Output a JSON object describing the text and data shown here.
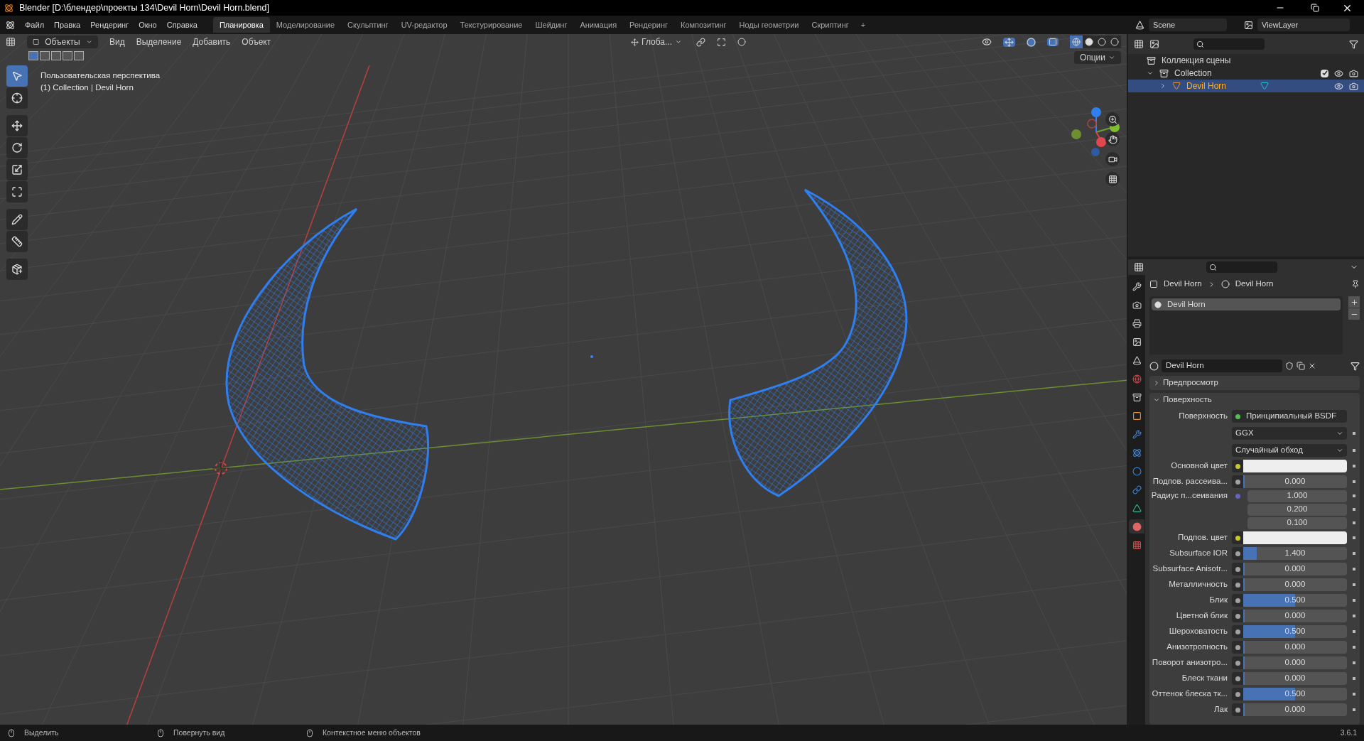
{
  "window": {
    "title": "Blender [D:\\блендер\\проекты 134\\Devil Horn\\Devil Horn.blend]"
  },
  "menu": [
    "Файл",
    "Правка",
    "Рендеринг",
    "Окно",
    "Справка"
  ],
  "workspaces": [
    {
      "label": "Планировка",
      "selected": true
    },
    {
      "label": "Моделирование",
      "selected": false
    },
    {
      "label": "Скульптинг",
      "selected": false
    },
    {
      "label": "UV-редактор",
      "selected": false
    },
    {
      "label": "Текстурирование",
      "selected": false
    },
    {
      "label": "Шейдинг",
      "selected": false
    },
    {
      "label": "Анимация",
      "selected": false
    },
    {
      "label": "Рендеринг",
      "selected": false
    },
    {
      "label": "Композитинг",
      "selected": false
    },
    {
      "label": "Ноды геометрии",
      "selected": false
    },
    {
      "label": "Скриптинг",
      "selected": false
    }
  ],
  "add_workspace": "+",
  "scene": "Scene",
  "view_layer": "ViewLayer",
  "viewport": {
    "mode": "Объекты",
    "menu": [
      "Вид",
      "Выделение",
      "Добавить",
      "Объект"
    ],
    "orientation": "Глоба...",
    "options": "Опции",
    "overlay_lines": [
      "Пользовательская перспектива",
      "(1) Collection | Devil Horn"
    ],
    "tools": [
      {
        "kind": "select",
        "selected": true
      },
      {
        "kind": "cursor",
        "selected": false
      },
      {
        "kind": "move",
        "selected": false
      },
      {
        "kind": "rotate",
        "selected": false
      },
      {
        "kind": "scale",
        "selected": false
      },
      {
        "kind": "transform",
        "selected": false
      },
      {
        "kind": "annotate",
        "selected": false
      },
      {
        "kind": "measure",
        "selected": false
      },
      {
        "kind": "add_cube",
        "selected": false
      }
    ],
    "shading": [
      {
        "kind": "wireframe",
        "selected": true
      },
      {
        "kind": "solid",
        "selected": false
      },
      {
        "kind": "material",
        "selected": false
      },
      {
        "kind": "rendered",
        "selected": false
      }
    ]
  },
  "outliner": {
    "root": "Коллекция сцены",
    "children": [
      {
        "label": "Collection",
        "expanded": true,
        "checked": true,
        "children": [
          {
            "label": "Devil Horn",
            "selected": true,
            "expanded": false
          }
        ]
      }
    ]
  },
  "properties": {
    "breadcrumb": [
      "Devil Horn",
      "Devil Horn"
    ],
    "tabs": [
      {
        "kind": "tool",
        "selected": false
      },
      {
        "kind": "render",
        "selected": false
      },
      {
        "kind": "output",
        "selected": false
      },
      {
        "kind": "view_layer",
        "selected": false
      },
      {
        "kind": "scene",
        "selected": false
      },
      {
        "kind": "world",
        "selected": false
      },
      {
        "kind": "collection",
        "selected": false
      },
      {
        "kind": "object",
        "selected": false
      },
      {
        "kind": "modifiers",
        "selected": false
      },
      {
        "kind": "particles",
        "selected": false
      },
      {
        "kind": "physics",
        "selected": false
      },
      {
        "kind": "constraints",
        "selected": false
      },
      {
        "kind": "data",
        "selected": false
      },
      {
        "kind": "material",
        "selected": true
      },
      {
        "kind": "texture",
        "selected": false
      }
    ],
    "material_slots": [
      {
        "label": "Devil Horn",
        "selected": true
      }
    ],
    "material_name": "Devil Horn",
    "panels": [
      {
        "label": "Предпросмотр",
        "expanded": false
      },
      {
        "label": "Поверхность",
        "expanded": true
      }
    ],
    "rows": [
      {
        "kind": "shader",
        "label": "Поверхность",
        "value": "Принципиальный BSDF",
        "color": "#4fc14f"
      },
      {
        "kind": "dropdown",
        "value": "GGX"
      },
      {
        "kind": "dropdown",
        "value": "Случайный обход"
      },
      {
        "kind": "color",
        "label": "Основной цвет",
        "color": "#c7c729"
      },
      {
        "kind": "slider",
        "label": "Подпов. рассеива...",
        "value": "0.000",
        "level": 0,
        "color": "#a1a1a1"
      },
      {
        "kind": "vector",
        "label": "Радиус п...сеивания",
        "values": [
          "1.000",
          "0.200",
          "0.100"
        ],
        "color": "#6363c7"
      },
      {
        "kind": "color",
        "label": "Подпов. цвет",
        "color": "#c7c729"
      },
      {
        "kind": "slider",
        "label": "Subsurface IOR",
        "value": "1.400",
        "level": 0.13,
        "color": "#a1a1a1"
      },
      {
        "kind": "slider",
        "label": "Subsurface Anisotr...",
        "value": "0.000",
        "level": 0,
        "color": "#a1a1a1"
      },
      {
        "kind": "slider",
        "label": "Металличность",
        "value": "0.000",
        "level": 0,
        "color": "#a1a1a1"
      },
      {
        "kind": "slider",
        "label": "Блик",
        "value": "0.500",
        "level": 0.5,
        "color": "#a1a1a1"
      },
      {
        "kind": "slider",
        "label": "Цветной блик",
        "value": "0.000",
        "level": 0,
        "color": "#a1a1a1"
      },
      {
        "kind": "slider",
        "label": "Шероховатость",
        "value": "0.500",
        "level": 0.5,
        "color": "#a1a1a1"
      },
      {
        "kind": "slider",
        "label": "Анизотропность",
        "value": "0.000",
        "level": 0,
        "color": "#a1a1a1"
      },
      {
        "kind": "slider",
        "label": "Поворот анизотро...",
        "value": "0.000",
        "level": 0,
        "color": "#a1a1a1"
      },
      {
        "kind": "slider",
        "label": "Блеск ткани",
        "value": "0.000",
        "level": 0,
        "color": "#a1a1a1"
      },
      {
        "kind": "slider",
        "label": "Оттенок блеска тк...",
        "value": "0.500",
        "level": 0.5,
        "color": "#a1a1a1"
      },
      {
        "kind": "slider",
        "label": "Лак",
        "value": "0.000",
        "level": 0,
        "color": "#a1a1a1"
      }
    ]
  },
  "status_bar": {
    "hints": [
      "Выделить",
      "Повернуть вид",
      "Контекстное меню объектов"
    ],
    "version": "3.6.1"
  }
}
